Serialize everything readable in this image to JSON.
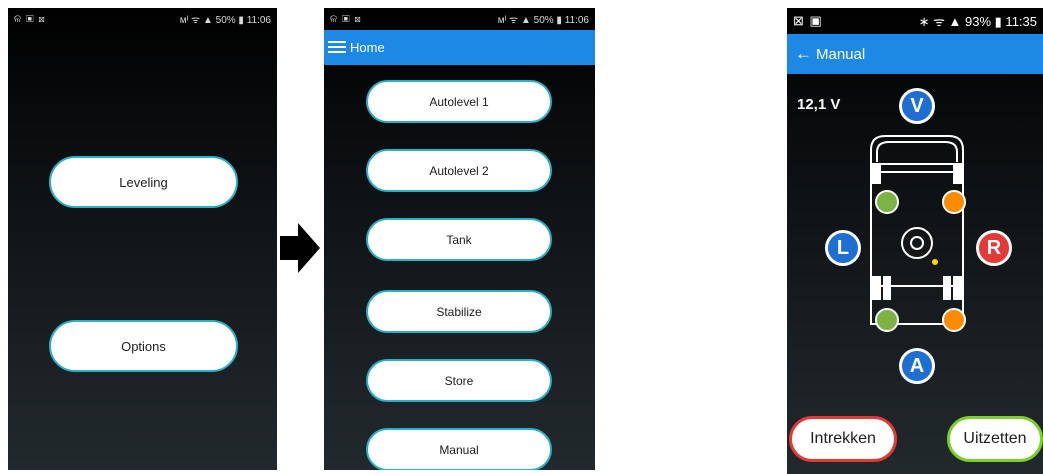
{
  "screen1": {
    "status": {
      "left_icons": "ଳ ▣ ⊠",
      "right": "ᴍᴵ ᯤ ▲ 50% ▮ 11:06"
    },
    "buttons": [
      "Leveling",
      "Options"
    ]
  },
  "screen2": {
    "status": {
      "left_icons": "ଳ ▣ ⊠",
      "right": "ᴍᴵ ᯤ ▲ 50% ▮ 11:06"
    },
    "appbar": {
      "title": "Home",
      "icon": "menu-icon"
    },
    "buttons": [
      "Autolevel 1",
      "Autolevel 2",
      "Tank",
      "Stabilize",
      "Store",
      "Manual"
    ]
  },
  "screen3": {
    "status": {
      "left_icons": "⊠ ▣",
      "right": "∗ ᯤ ▲ 93% ▮ 11:35"
    },
    "appbar": {
      "title": "Manual",
      "icon": "back-arrow-icon"
    },
    "voltage": "12,1 V",
    "direction_buttons": {
      "front": "V",
      "left": "L",
      "right": "R",
      "back": "A"
    },
    "actions": {
      "retract": "Intrekken",
      "extend": "Uitzetten"
    },
    "colors": {
      "front_back": "#1e6fd1",
      "left": "#1e6fd1",
      "right": "#e53935",
      "leg_green": "#7cb342",
      "leg_orange": "#fb8c00",
      "retract_border": "#e53935",
      "extend_border": "#7cd02a"
    }
  },
  "arrow_icon": "right-arrow-icon"
}
